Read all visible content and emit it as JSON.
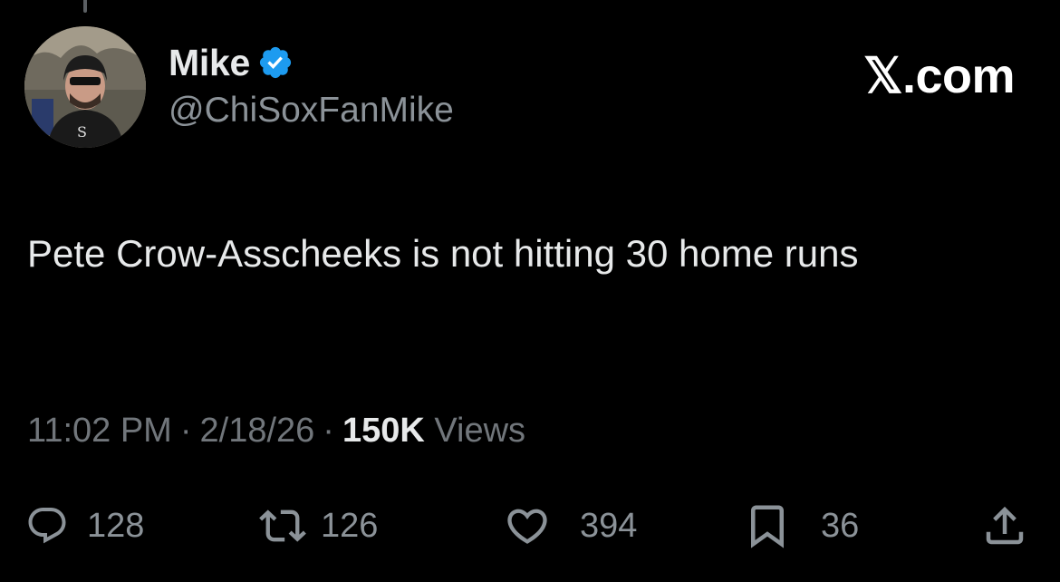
{
  "author": {
    "display_name": "Mike",
    "handle": "@ChiSoxFanMike",
    "verified": true,
    "verified_color": "#1d9bf0"
  },
  "site_mark": "𝕏.com",
  "tweet": {
    "text": "Pete Crow-Asscheeks is not hitting 30 home runs"
  },
  "meta": {
    "time": "11:02 PM",
    "separator": "·",
    "date": "2/18/26",
    "views_count": "150K",
    "views_label": "Views"
  },
  "actions": {
    "replies": {
      "icon": "reply-icon",
      "count": "128"
    },
    "reposts": {
      "icon": "repost-icon",
      "count": "126"
    },
    "likes": {
      "icon": "heart-icon",
      "count": "394"
    },
    "bookmarks": {
      "icon": "bookmark-icon",
      "count": "36"
    },
    "share": {
      "icon": "share-icon"
    }
  },
  "colors": {
    "background": "#000000",
    "primary_text": "#e7e9ea",
    "secondary_text": "#71767b"
  }
}
